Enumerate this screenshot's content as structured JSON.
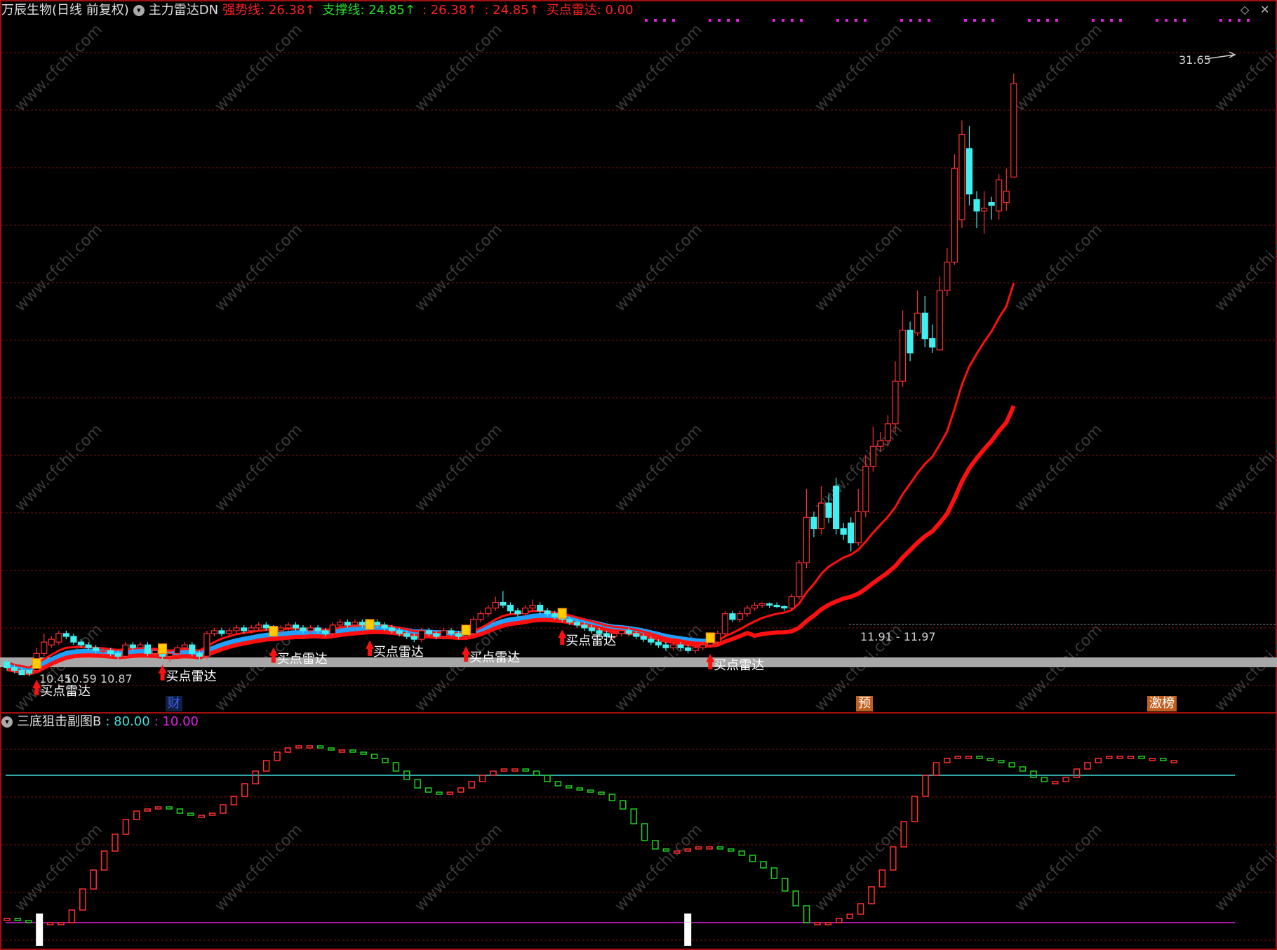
{
  "header": {
    "title": "万辰生物(日线 前复权)",
    "indicator": "主力雷达DN",
    "items": [
      {
        "label": "强势线:",
        "value": "26.38↑",
        "color": "#ff2020"
      },
      {
        "label": "支撑线:",
        "value": "24.85↑",
        "color": "#20e020"
      },
      {
        "label": ":",
        "value": "26.38↑",
        "color": "#ff2020"
      },
      {
        "label": ":",
        "value": "24.85↑",
        "color": "#ff2020"
      },
      {
        "label": "买点雷达:",
        "value": "0.00",
        "color": "#ff2020"
      }
    ]
  },
  "sub_header": {
    "title": "三底狙击副图B",
    "v1": ": 80.00",
    "v2": ": 10.00",
    "c1": "#40e0e0",
    "c2": "#e020e0"
  },
  "badges": [
    {
      "text": "财",
      "color": "#4060ff",
      "bg": "#102040"
    },
    {
      "text": "预",
      "color": "#ffffff",
      "bg": "#c06020"
    },
    {
      "text": "激榜",
      "color": "#ffffff",
      "bg": "#c06020"
    }
  ],
  "annotations": {
    "high_label": "31.65",
    "low_label": "10.45",
    "low_label2": "10.59 10.87",
    "mid_label": "11.91 - 11.97",
    "signal_text": "买点雷达"
  },
  "watermark": "www.cfchi.com",
  "colors": {
    "up": "#ff3030",
    "down": "#40f0f0",
    "ema_red": "#ff1010",
    "ema_blue": "#20a0ff",
    "grid": "#7a1010",
    "green_step": "#20d020"
  },
  "chart_data": {
    "type": "candlestick",
    "ylim": [
      9.5,
      33.5
    ],
    "candles": [
      [
        10.9,
        10.7,
        11.0,
        10.6
      ],
      [
        10.7,
        10.6,
        10.8,
        10.5
      ],
      [
        10.6,
        10.45,
        10.7,
        10.45
      ],
      [
        10.6,
        10.5,
        10.6,
        10.4
      ],
      [
        10.6,
        11.2,
        11.4,
        10.6
      ],
      [
        11.2,
        11.6,
        11.9,
        11.1
      ],
      [
        11.5,
        11.7,
        11.8,
        11.4
      ],
      [
        11.6,
        11.9,
        12.0,
        11.5
      ],
      [
        11.9,
        11.8,
        12.0,
        11.7
      ],
      [
        11.8,
        11.6,
        11.9,
        11.5
      ],
      [
        11.6,
        11.5,
        11.7,
        11.4
      ],
      [
        11.5,
        11.4,
        11.6,
        11.3
      ],
      [
        11.4,
        11.3,
        11.5,
        11.2
      ],
      [
        11.3,
        11.3,
        11.4,
        11.1
      ],
      [
        11.3,
        11.2,
        11.4,
        11.1
      ],
      [
        11.2,
        11.1,
        11.3,
        11.0
      ],
      [
        11.1,
        11.5,
        11.6,
        11.0
      ],
      [
        11.5,
        11.4,
        11.6,
        11.3
      ],
      [
        11.4,
        11.5,
        11.6,
        11.3
      ],
      [
        11.5,
        11.2,
        11.6,
        11.1
      ],
      [
        11.2,
        11.3,
        11.4,
        11.1
      ],
      [
        11.3,
        11.1,
        11.4,
        11.0
      ],
      [
        11.1,
        11.2,
        11.3,
        10.9
      ],
      [
        11.2,
        11.4,
        11.5,
        11.1
      ],
      [
        11.4,
        11.5,
        11.6,
        11.3
      ],
      [
        11.5,
        11.2,
        11.6,
        11.1
      ],
      [
        11.2,
        11.1,
        11.3,
        10.9
      ],
      [
        11.1,
        11.9,
        12.0,
        11.0
      ],
      [
        11.9,
        12.0,
        12.1,
        11.8
      ],
      [
        12.0,
        11.9,
        12.1,
        11.8
      ],
      [
        11.9,
        12.0,
        12.1,
        11.8
      ],
      [
        12.0,
        12.1,
        12.2,
        11.9
      ],
      [
        12.1,
        12.0,
        12.2,
        11.9
      ],
      [
        12.0,
        12.1,
        12.2,
        11.9
      ],
      [
        12.1,
        12.2,
        12.3,
        12.0
      ],
      [
        12.2,
        12.1,
        12.3,
        12.0
      ],
      [
        12.1,
        12.0,
        12.2,
        11.9
      ],
      [
        12.0,
        12.1,
        12.2,
        11.9
      ],
      [
        12.1,
        12.2,
        12.3,
        12.0
      ],
      [
        12.2,
        12.1,
        12.3,
        12.0
      ],
      [
        12.1,
        12.0,
        12.2,
        11.9
      ],
      [
        12.0,
        12.1,
        12.2,
        11.9
      ],
      [
        12.1,
        12.0,
        12.2,
        11.9
      ],
      [
        12.0,
        11.9,
        12.1,
        11.8
      ],
      [
        11.9,
        12.2,
        12.3,
        11.8
      ],
      [
        12.2,
        12.3,
        12.4,
        12.1
      ],
      [
        12.3,
        12.2,
        12.4,
        12.1
      ],
      [
        12.2,
        12.3,
        12.4,
        12.1
      ],
      [
        12.3,
        12.2,
        12.4,
        12.1
      ],
      [
        12.2,
        12.3,
        12.4,
        12.1
      ],
      [
        12.3,
        12.2,
        12.4,
        12.1
      ],
      [
        12.2,
        12.1,
        12.3,
        12.0
      ],
      [
        12.1,
        12.0,
        12.2,
        11.9
      ],
      [
        12.0,
        11.9,
        12.1,
        11.8
      ],
      [
        11.9,
        11.8,
        12.0,
        11.7
      ],
      [
        11.8,
        11.7,
        11.9,
        11.6
      ],
      [
        11.7,
        12.0,
        12.1,
        11.6
      ],
      [
        12.0,
        11.9,
        12.1,
        11.8
      ],
      [
        11.9,
        11.8,
        12.0,
        11.7
      ],
      [
        11.8,
        12.0,
        12.1,
        11.7
      ],
      [
        12.0,
        11.9,
        12.1,
        11.8
      ],
      [
        11.9,
        11.8,
        12.0,
        11.7
      ],
      [
        11.8,
        11.9,
        12.0,
        11.7
      ],
      [
        11.9,
        12.4,
        12.5,
        11.8
      ],
      [
        12.4,
        12.6,
        12.7,
        12.3
      ],
      [
        12.6,
        12.8,
        12.9,
        12.5
      ],
      [
        12.8,
        13.0,
        13.2,
        12.7
      ],
      [
        13.0,
        12.9,
        13.4,
        12.8
      ],
      [
        12.9,
        12.7,
        13.0,
        12.6
      ],
      [
        12.7,
        12.6,
        12.8,
        12.5
      ],
      [
        12.6,
        12.8,
        12.9,
        12.5
      ],
      [
        12.8,
        12.9,
        13.1,
        12.7
      ],
      [
        12.9,
        12.7,
        13.0,
        12.6
      ],
      [
        12.7,
        12.6,
        12.8,
        12.5
      ],
      [
        12.6,
        12.5,
        12.7,
        12.4
      ],
      [
        12.5,
        12.4,
        12.6,
        12.3
      ],
      [
        12.4,
        12.3,
        12.5,
        12.2
      ],
      [
        12.3,
        12.2,
        12.4,
        12.1
      ],
      [
        12.2,
        12.1,
        12.3,
        12.0
      ],
      [
        12.1,
        12.0,
        12.2,
        11.9
      ],
      [
        12.0,
        11.9,
        12.1,
        11.8
      ],
      [
        11.9,
        11.8,
        12.0,
        11.7
      ],
      [
        11.8,
        11.9,
        12.0,
        11.7
      ],
      [
        11.9,
        12.0,
        12.1,
        11.8
      ],
      [
        12.0,
        11.9,
        12.1,
        11.8
      ],
      [
        11.9,
        11.8,
        12.0,
        11.7
      ],
      [
        11.8,
        11.7,
        11.9,
        11.6
      ],
      [
        11.7,
        11.6,
        11.8,
        11.5
      ],
      [
        11.6,
        11.5,
        11.7,
        11.4
      ],
      [
        11.5,
        11.4,
        11.6,
        11.3
      ],
      [
        11.4,
        11.5,
        11.6,
        11.3
      ],
      [
        11.5,
        11.4,
        11.6,
        11.3
      ],
      [
        11.4,
        11.3,
        11.5,
        11.2
      ],
      [
        11.3,
        11.4,
        11.5,
        11.2
      ],
      [
        11.4,
        11.5,
        11.6,
        11.3
      ],
      [
        11.5,
        11.6,
        11.7,
        11.4
      ],
      [
        11.6,
        11.91,
        12.0,
        11.5
      ],
      [
        11.9,
        12.6,
        12.7,
        11.8
      ],
      [
        12.6,
        12.4,
        12.7,
        12.3
      ],
      [
        12.4,
        12.6,
        12.7,
        12.3
      ],
      [
        12.6,
        12.8,
        12.9,
        12.5
      ],
      [
        12.8,
        12.9,
        13.0,
        12.7
      ],
      [
        12.9,
        12.95,
        13.0,
        12.8
      ],
      [
        12.95,
        12.9,
        13.0,
        12.8
      ],
      [
        12.9,
        12.85,
        13.0,
        12.8
      ],
      [
        12.85,
        12.8,
        12.9,
        12.7
      ],
      [
        12.8,
        13.2,
        13.3,
        12.7
      ],
      [
        13.2,
        14.4,
        14.5,
        13.1
      ],
      [
        14.4,
        16.0,
        17.0,
        14.2
      ],
      [
        16.0,
        15.6,
        16.2,
        15.3
      ],
      [
        15.6,
        16.5,
        17.1,
        15.4
      ],
      [
        16.5,
        16.0,
        16.8,
        15.8
      ],
      [
        17.1,
        15.6,
        17.4,
        15.4
      ],
      [
        15.6,
        15.4,
        15.8,
        15.2
      ],
      [
        15.8,
        15.1,
        16.0,
        14.8
      ],
      [
        15.1,
        16.2,
        17.0,
        15.0
      ],
      [
        16.2,
        17.8,
        18.2,
        16.0
      ],
      [
        17.8,
        18.5,
        19.2,
        17.6
      ],
      [
        18.5,
        18.7,
        19.0,
        18.3
      ],
      [
        18.7,
        19.3,
        19.6,
        18.5
      ],
      [
        19.3,
        20.8,
        21.5,
        19.0
      ],
      [
        20.8,
        22.6,
        23.3,
        20.6
      ],
      [
        22.6,
        21.8,
        22.9,
        21.5
      ],
      [
        22.5,
        23.2,
        24.0,
        22.4
      ],
      [
        23.2,
        22.3,
        23.8,
        22.0
      ],
      [
        22.3,
        22.0,
        22.8,
        21.8
      ],
      [
        21.9,
        24.0,
        24.5,
        21.9
      ],
      [
        24.0,
        25.0,
        25.5,
        23.8
      ],
      [
        25.0,
        28.3,
        28.8,
        24.9
      ],
      [
        26.5,
        29.5,
        30.0,
        26.2
      ],
      [
        29.0,
        27.4,
        29.8,
        27.0
      ],
      [
        27.2,
        26.8,
        27.5,
        26.2
      ],
      [
        26.8,
        26.9,
        27.5,
        26.0
      ],
      [
        27.1,
        27.0,
        27.3,
        26.5
      ],
      [
        26.8,
        27.9,
        28.1,
        26.5
      ],
      [
        27.1,
        27.5,
        28.3,
        26.8
      ],
      [
        28.0,
        31.3,
        31.65,
        28.0
      ]
    ],
    "ema_fast": [
      10.9,
      10.8,
      10.75,
      10.7,
      10.85,
      11.0,
      11.15,
      11.3,
      11.4,
      11.42,
      11.43,
      11.42,
      11.4,
      11.38,
      11.35,
      11.32,
      11.35,
      11.37,
      11.4,
      11.37,
      11.36,
      11.32,
      11.3,
      11.32,
      11.36,
      11.34,
      11.3,
      11.45,
      11.6,
      11.72,
      11.8,
      11.88,
      11.92,
      11.96,
      12.0,
      12.03,
      12.03,
      12.04,
      12.07,
      12.08,
      12.06,
      12.07,
      12.06,
      12.03,
      12.06,
      12.12,
      12.15,
      12.18,
      12.19,
      12.21,
      12.21,
      12.19,
      12.15,
      12.1,
      12.05,
      11.98,
      11.98,
      11.96,
      11.93,
      11.94,
      11.93,
      11.9,
      11.9,
      11.98,
      12.1,
      12.24,
      12.4,
      12.52,
      12.58,
      12.6,
      12.64,
      12.7,
      12.7,
      12.68,
      12.64,
      12.6,
      12.54,
      12.47,
      12.4,
      12.33,
      12.26,
      12.18,
      12.14,
      12.12,
      12.08,
      12.03,
      11.97,
      11.9,
      11.82,
      11.74,
      11.7,
      11.66,
      11.61,
      11.58,
      11.57,
      11.58,
      11.64,
      11.8,
      11.92,
      12.05,
      12.2,
      12.33,
      12.45,
      12.53,
      12.6,
      12.64,
      12.73,
      12.96,
      13.35,
      13.65,
      14.0,
      14.26,
      14.42,
      14.58,
      14.68,
      14.86,
      15.14,
      15.46,
      15.74,
      16.02,
      16.36,
      16.82,
      17.18,
      17.56,
      17.88,
      18.13,
      18.56,
      19.03,
      19.82,
      20.68,
      21.32,
      21.77,
      22.18,
      22.56,
      23.03,
      23.44,
      24.26
    ],
    "ema_slow": [
      10.8,
      10.75,
      10.7,
      10.65,
      10.72,
      10.85,
      10.98,
      11.1,
      11.2,
      11.25,
      11.27,
      11.28,
      11.27,
      11.26,
      11.24,
      11.22,
      11.24,
      11.26,
      11.28,
      11.27,
      11.26,
      11.24,
      11.22,
      11.23,
      11.25,
      11.24,
      11.21,
      11.3,
      11.4,
      11.5,
      11.58,
      11.65,
      11.7,
      11.75,
      11.8,
      11.84,
      11.86,
      11.88,
      11.91,
      11.93,
      11.93,
      11.95,
      11.95,
      11.93,
      11.96,
      12.0,
      12.03,
      12.06,
      12.08,
      12.1,
      12.11,
      12.1,
      12.08,
      12.05,
      12.01,
      11.96,
      11.96,
      11.95,
      11.93,
      11.93,
      11.92,
      11.9,
      11.9,
      11.95,
      12.03,
      12.13,
      12.24,
      12.33,
      12.39,
      12.42,
      12.46,
      12.51,
      12.53,
      12.53,
      12.51,
      12.49,
      12.45,
      12.4,
      12.35,
      12.29,
      12.24,
      12.17,
      12.13,
      12.11,
      12.08,
      12.04,
      11.99,
      11.93,
      11.87,
      11.8,
      11.76,
      11.72,
      11.68,
      11.65,
      11.63,
      11.63,
      11.66,
      11.77,
      11.86,
      11.96,
      12.07,
      12.17,
      12.27,
      12.35,
      12.42,
      12.47,
      12.55,
      12.72,
      13.0,
      13.24,
      13.5,
      13.71,
      13.87,
      14.02,
      14.13,
      14.28,
      14.5,
      14.75,
      14.98,
      15.21,
      15.48,
      15.83,
      16.13,
      16.44,
      16.71,
      16.93,
      17.27,
      17.64,
      18.22,
      18.87,
      19.38,
      19.78,
      20.14,
      20.48,
      20.87,
      21.22,
      21.85
    ],
    "signals": [
      4,
      21,
      36,
      49,
      62,
      75,
      95
    ],
    "series": [
      {
        "values": [
          12,
          11,
          10,
          10,
          10,
          10,
          16,
          26,
          35,
          44,
          52,
          59,
          63,
          64,
          65,
          64,
          62,
          61,
          61,
          62,
          66,
          70,
          76,
          82,
          87,
          91,
          93,
          94,
          94,
          93,
          92,
          92,
          91,
          90,
          88,
          86,
          82,
          78,
          74,
          72,
          71,
          72,
          74,
          77,
          80,
          82,
          83,
          83,
          82,
          80,
          77,
          75,
          74,
          73,
          72,
          71,
          68,
          64,
          57,
          49,
          45,
          44,
          44,
          45,
          46,
          46,
          45,
          44,
          42,
          39,
          36,
          31,
          25,
          18,
          10,
          10,
          10,
          12,
          14,
          19,
          27,
          35,
          46,
          58,
          70,
          80,
          86,
          88,
          89,
          89,
          88,
          87,
          86,
          84,
          82,
          79,
          77,
          77,
          79,
          83,
          86,
          88,
          89,
          89,
          89,
          88,
          88,
          87,
          87
        ]
      }
    ],
    "levels": [
      80,
      10
    ],
    "sub_ylim": [
      5,
      100
    ]
  }
}
